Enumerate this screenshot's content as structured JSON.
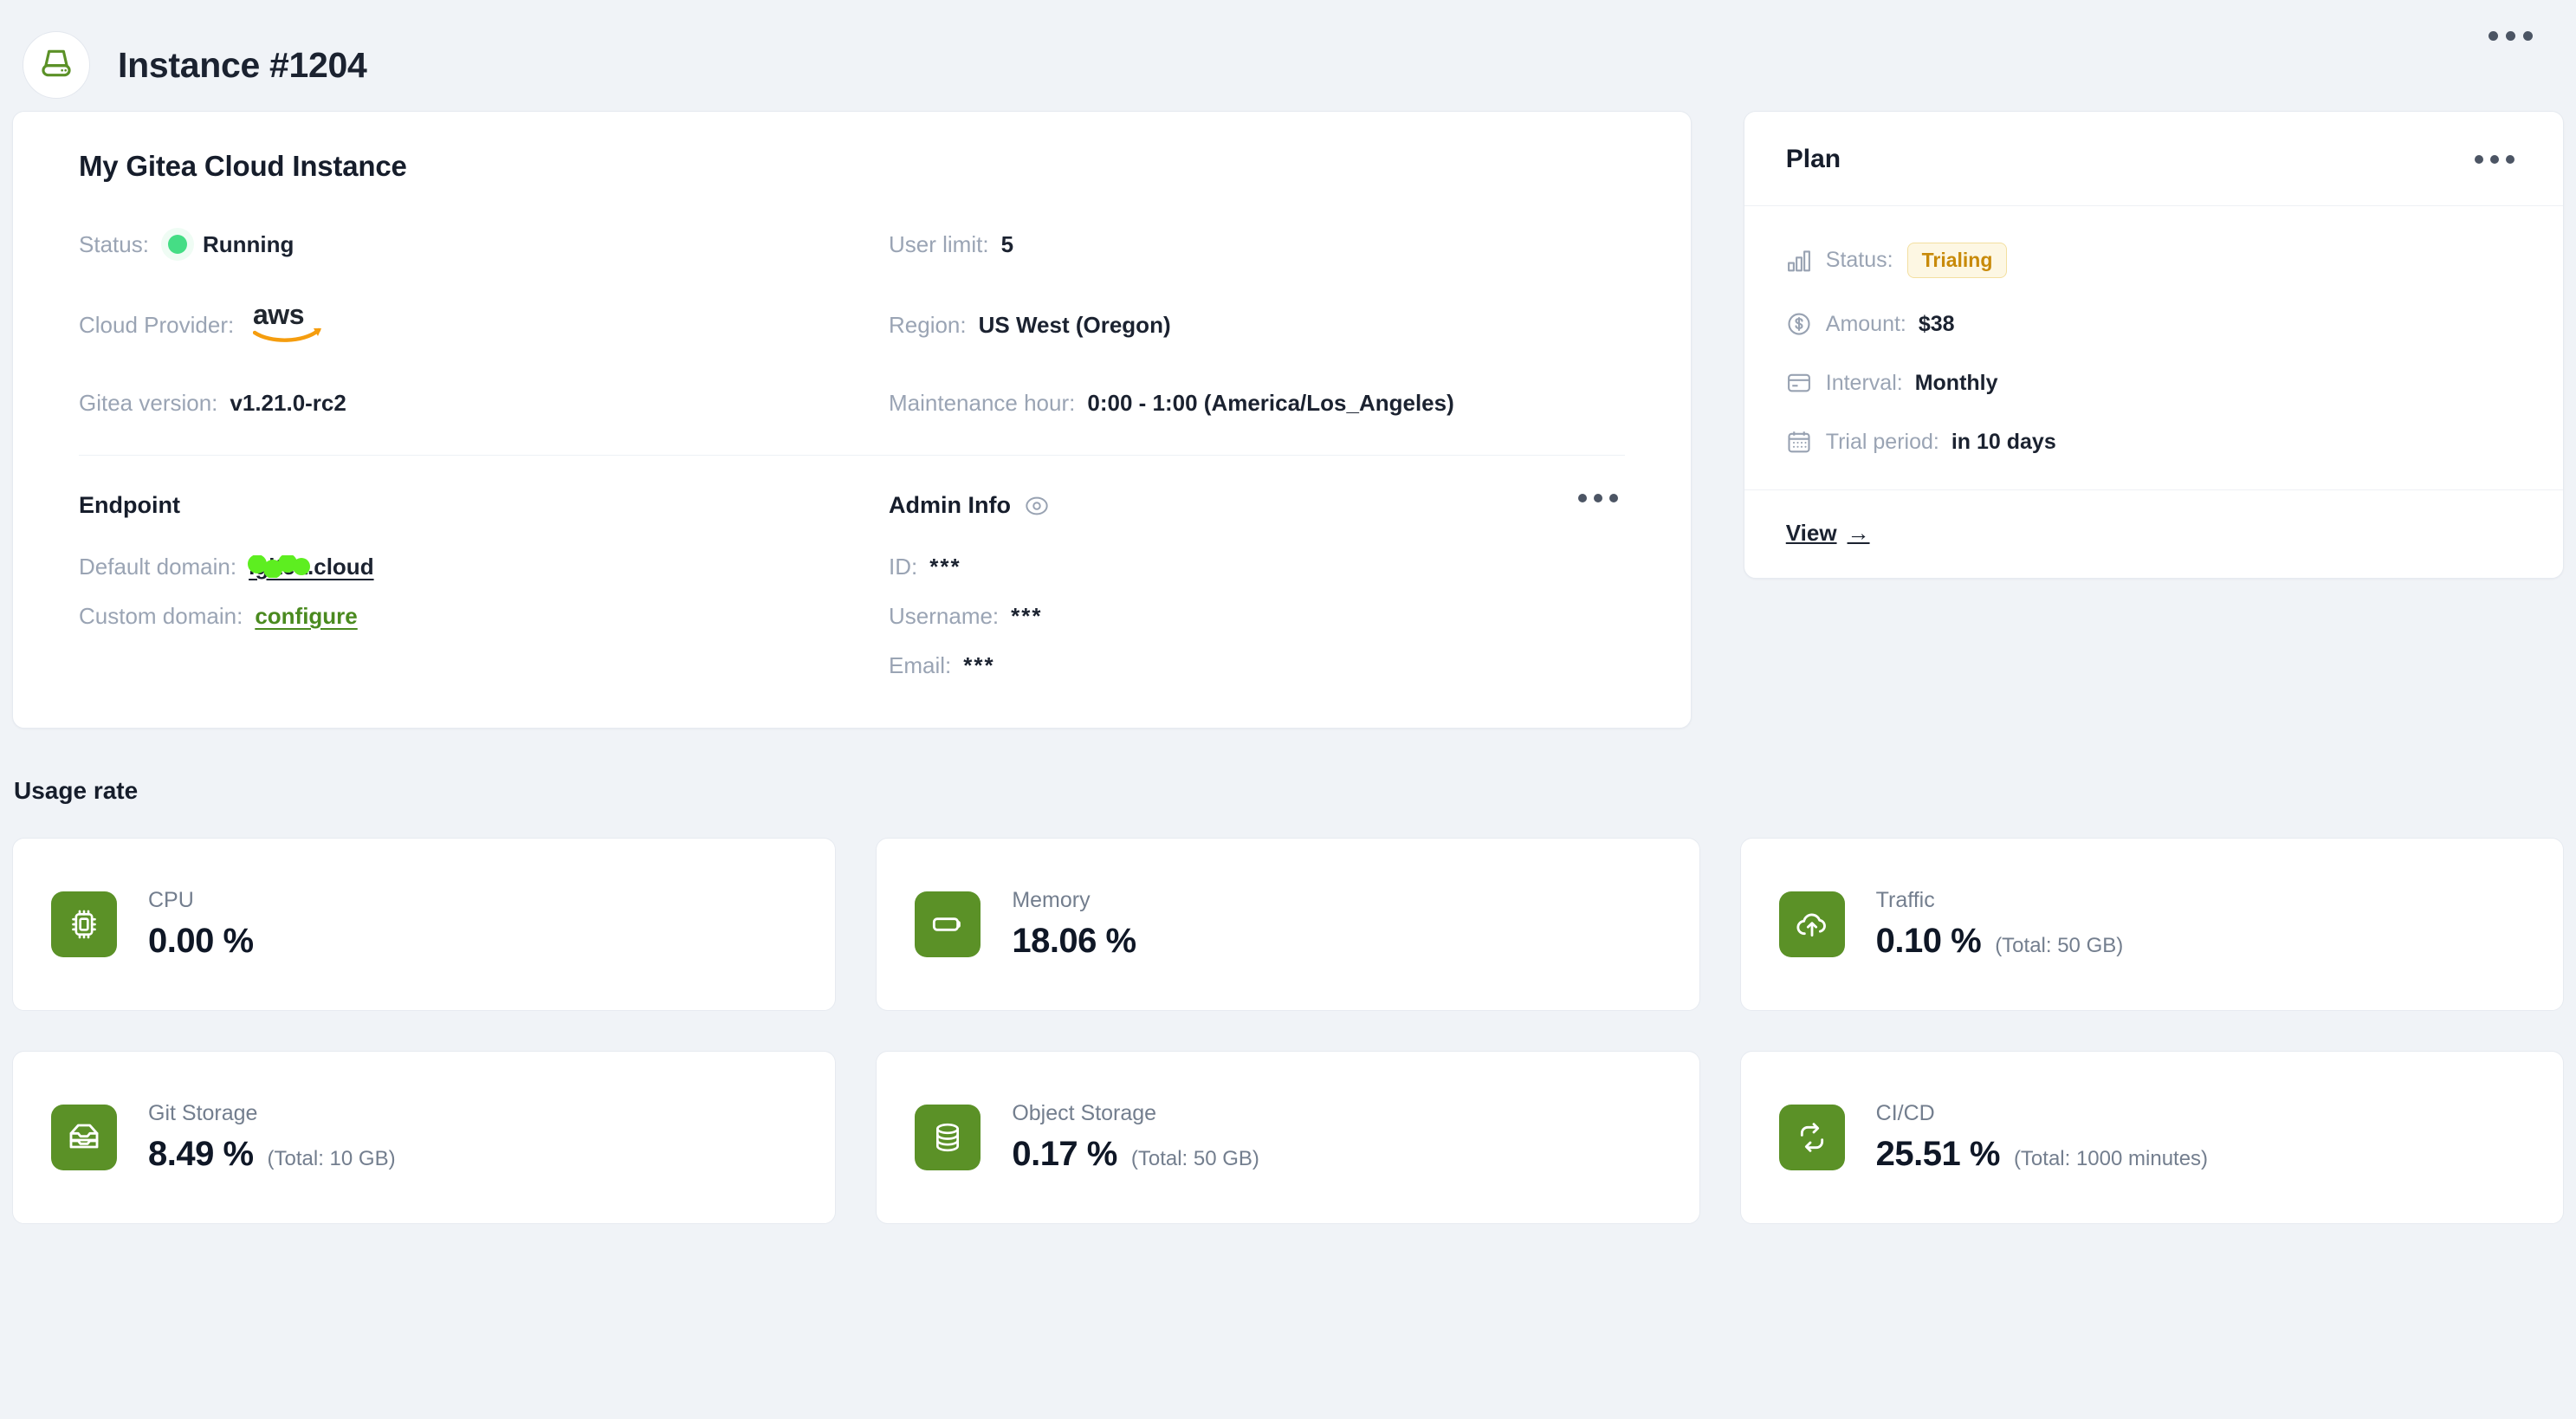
{
  "header": {
    "title": "Instance #1204",
    "logo_icon": "server-drive-icon",
    "menu_icon": "more-options-icon"
  },
  "instance": {
    "name": "My Gitea Cloud Instance",
    "fields": {
      "status_label": "Status:",
      "status_value": "Running",
      "cloud_provider_label": "Cloud Provider:",
      "cloud_provider_value": "aws",
      "gitea_version_label": "Gitea version:",
      "gitea_version_value": "v1.21.0-rc2",
      "user_limit_label": "User limit:",
      "user_limit_value": "5",
      "region_label": "Region:",
      "region_value": "US West (Oregon)",
      "maintenance_label": "Maintenance hour:",
      "maintenance_value": "0:00 - 1:00 (America/Los_Angeles)"
    },
    "endpoint": {
      "heading": "Endpoint",
      "default_domain_label": "Default domain:",
      "default_domain_value": ".gitea.cloud",
      "custom_domain_label": "Custom domain:",
      "custom_domain_link": "configure"
    },
    "admin": {
      "heading": "Admin Info",
      "reveal_icon": "eye-icon",
      "menu_icon": "more-options-icon",
      "id_label": "ID:",
      "id_value": "***",
      "username_label": "Username:",
      "username_value": "***",
      "email_label": "Email:",
      "email_value": "***"
    }
  },
  "plan": {
    "title": "Plan",
    "menu_icon": "more-options-icon",
    "rows": [
      {
        "icon": "bar-chart-icon",
        "label": "Status:",
        "value": "Trialing",
        "is_badge": true
      },
      {
        "icon": "dollar-circle-icon",
        "label": "Amount:",
        "value": "$38",
        "is_badge": false
      },
      {
        "icon": "credit-card-icon",
        "label": "Interval:",
        "value": "Monthly",
        "is_badge": false
      },
      {
        "icon": "calendar-icon",
        "label": "Trial period:",
        "value": "in 10 days",
        "is_badge": false
      }
    ],
    "view_link": "View",
    "view_arrow": "→"
  },
  "usage": {
    "section_title": "Usage rate",
    "cards": [
      {
        "icon": "cpu-chip-icon",
        "label": "CPU",
        "value": "0.00 %",
        "total": ""
      },
      {
        "icon": "memory-stick-icon",
        "label": "Memory",
        "value": "18.06 %",
        "total": ""
      },
      {
        "icon": "cloud-upload-icon",
        "label": "Traffic",
        "value": "0.10 %",
        "total": "(Total: 50 GB)"
      },
      {
        "icon": "archive-box-icon",
        "label": "Git Storage",
        "value": "8.49 %",
        "total": "(Total: 10 GB)"
      },
      {
        "icon": "database-stack-icon",
        "label": "Object Storage",
        "value": "0.17 %",
        "total": "(Total: 50 GB)"
      },
      {
        "icon": "sync-loop-icon",
        "label": "CI/CD",
        "value": "25.51 %",
        "total": "(Total: 1000 minutes)"
      }
    ]
  },
  "colors": {
    "page_background": "#f0f3f7",
    "card_background": "#ffffff",
    "brand_green": "#5b9127",
    "status_green": "#45dd85",
    "badge_amber_text": "#c88a09",
    "badge_amber_bg": "#fdf7e3",
    "link_green": "#4a8a1f",
    "redaction_green": "#5dee20",
    "muted_text": "#9aa4b4",
    "dark_text": "#1b2230"
  }
}
